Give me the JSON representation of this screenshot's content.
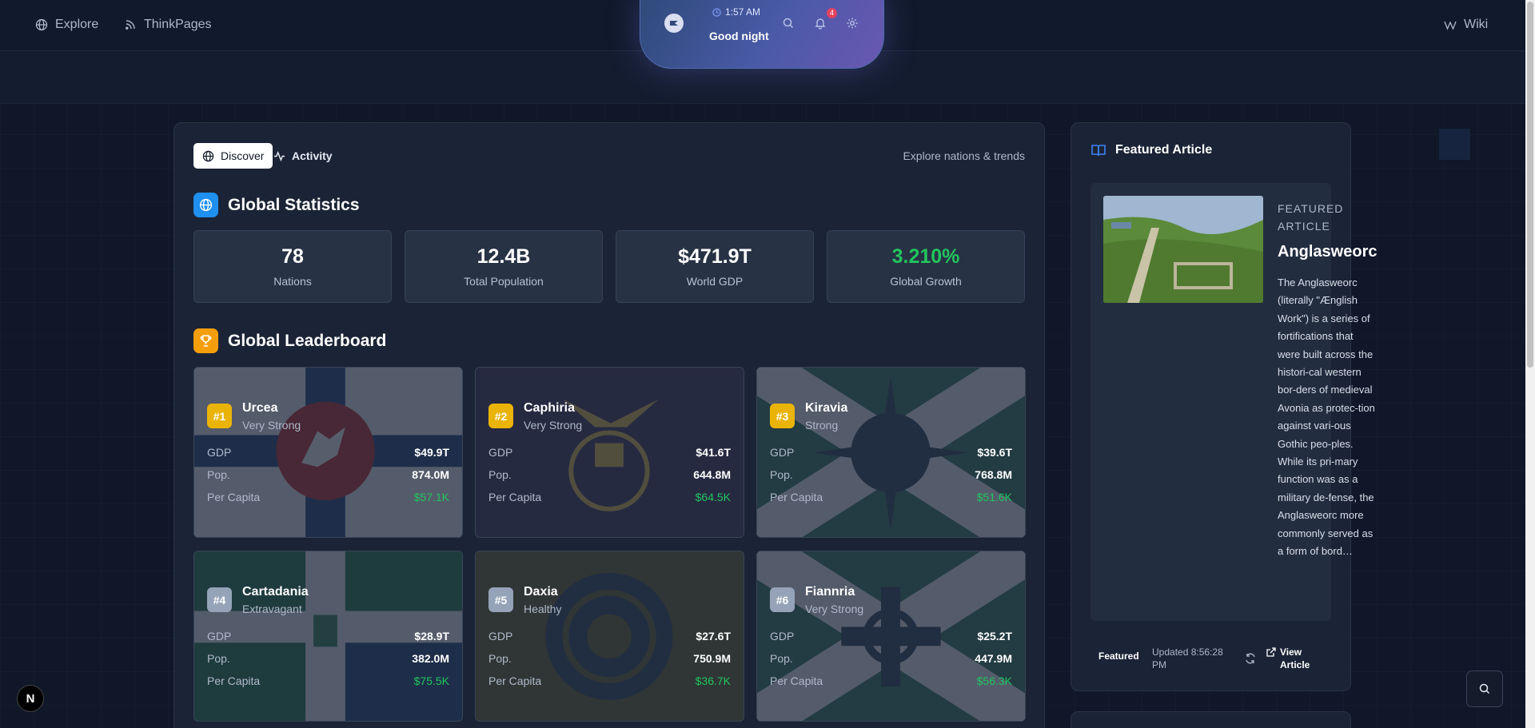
{
  "nav": {
    "explore_label": "Explore",
    "thinkpages_label": "ThinkPages",
    "wiki_label": "Wiki"
  },
  "island": {
    "time": "1:57 AM",
    "greeting": "Good night",
    "notification_count": "4"
  },
  "main": {
    "tabs": [
      {
        "label": "Discover",
        "icon": "globe-icon",
        "active": true
      },
      {
        "label": "Activity",
        "icon": "activity-icon",
        "active": false
      }
    ],
    "note": "Explore nations & trends"
  },
  "global_stats": {
    "title": "Global Statistics",
    "items": [
      {
        "value": "78",
        "label": "Nations",
        "color": "#ffffff"
      },
      {
        "value": "12.4B",
        "label": "Total Population",
        "color": "#ffffff"
      },
      {
        "value": "$471.9T",
        "label": "World GDP",
        "color": "#ffffff"
      },
      {
        "value": "3.210%",
        "label": "Global Growth",
        "color": "#22c55e"
      }
    ]
  },
  "leaderboard": {
    "title": "Global Leaderboard",
    "labels": {
      "gdp": "GDP",
      "pop": "Pop.",
      "per_capita": "Per Capita"
    },
    "nations": [
      {
        "rank": "#1",
        "name": "Urcea",
        "tier": "Very Strong",
        "gdp": "$49.9T",
        "pop": "874.0M",
        "per_capita": "$57.1K"
      },
      {
        "rank": "#2",
        "name": "Caphiria",
        "tier": "Very Strong",
        "gdp": "$41.6T",
        "pop": "644.8M",
        "per_capita": "$64.5K"
      },
      {
        "rank": "#3",
        "name": "Kiravia",
        "tier": "Strong",
        "gdp": "$39.6T",
        "pop": "768.8M",
        "per_capita": "$51.6K"
      },
      {
        "rank": "#4",
        "name": "Cartadania",
        "tier": "Extravagant",
        "gdp": "$28.9T",
        "pop": "382.0M",
        "per_capita": "$75.5K"
      },
      {
        "rank": "#5",
        "name": "Daxia",
        "tier": "Healthy",
        "gdp": "$27.6T",
        "pop": "750.9M",
        "per_capita": "$36.7K"
      },
      {
        "rank": "#6",
        "name": "Fiannria",
        "tier": "Very Strong",
        "gdp": "$25.2T",
        "pop": "447.9M",
        "per_capita": "$56.3K"
      }
    ]
  },
  "featured": {
    "heading": "Featured Article",
    "kicker": "FEATURED ARTICLE",
    "title": "Anglasweorc",
    "excerpt": "The Anglasweorc (literally \"Ænglish Work\") is a series of fortifications that were built across the histori-cal western bor-ders of medieval Avonia as protec-tion against vari-ous Gothic peo-ples. While its pri-mary function was as a military de-fense, the Anglasweorc more commonly served as a form of bord…",
    "badge": "Featured",
    "updated": "Updated 8:56:28 PM",
    "view_label": "View Article"
  },
  "colors": {
    "accent_blue": "#3b82f6",
    "gold": "#f59e0b",
    "silver": "#94a3b8",
    "bronze": "#d97706",
    "green": "#22c55e"
  }
}
